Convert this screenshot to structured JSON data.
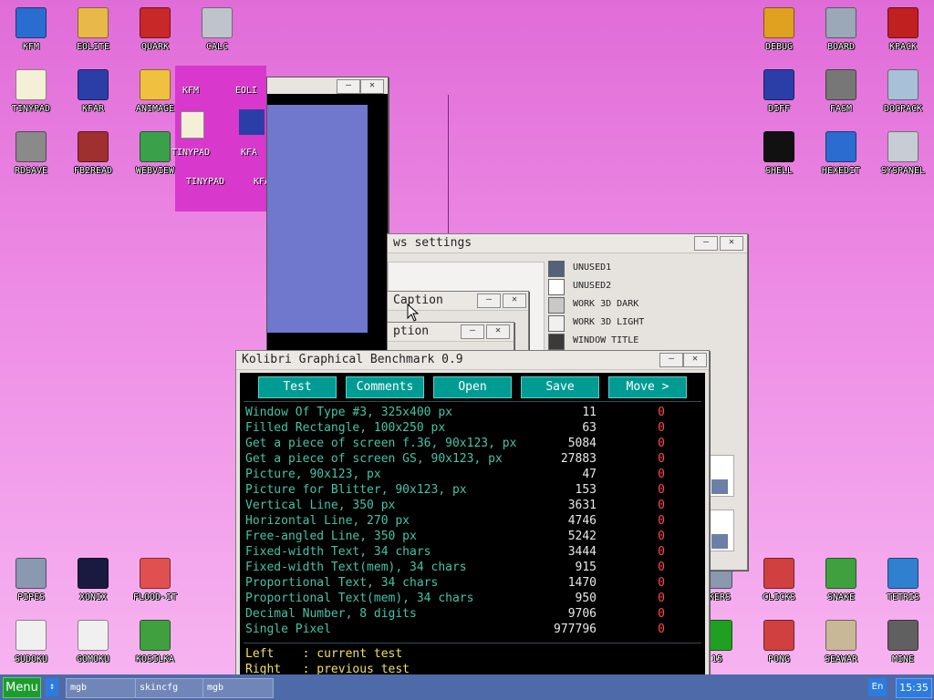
{
  "desktop_icons_left": [
    {
      "label": "KFM",
      "icon": "floppy-icon",
      "color": "#2b6cd0"
    },
    {
      "label": "EOLITE",
      "icon": "folder-icon",
      "color": "#e8b84a"
    },
    {
      "label": "QUARK",
      "icon": "book-icon",
      "color": "#c82828"
    },
    {
      "label": "CALC",
      "icon": "calculator-icon",
      "color": "#bfc4cc"
    },
    {
      "label": "TINYPAD",
      "icon": "notepad-icon",
      "color": "#f4f0d8"
    },
    {
      "label": "KFAR",
      "icon": "far-icon",
      "color": "#2b3ea8"
    },
    {
      "label": "ANIMAGE",
      "icon": "pencil-icon",
      "color": "#f0c040"
    },
    {
      "label": "RDSAVE",
      "icon": "disk-save-icon",
      "color": "#8a8a8a"
    },
    {
      "label": "FB2READ",
      "icon": "fb2-book-icon",
      "color": "#a03030"
    },
    {
      "label": "WEBVIEW",
      "icon": "globe-icon",
      "color": "#3aa04a"
    }
  ],
  "desktop_icons_right": [
    {
      "label": "DEBUG",
      "icon": "bug-icon",
      "color": "#e0a020"
    },
    {
      "label": "BOARD",
      "icon": "board-icon",
      "color": "#9aa8b8"
    },
    {
      "label": "KPACK",
      "icon": "wrench-icon",
      "color": "#c02020"
    },
    {
      "label": "DIFF",
      "icon": "diff-icon",
      "color": "#2b3ea8"
    },
    {
      "label": "FASM",
      "icon": "anvil-icon",
      "color": "#777777"
    },
    {
      "label": "DOCPACK",
      "icon": "cabinet-icon",
      "color": "#a8c0d8"
    },
    {
      "label": "SHELL",
      "icon": "terminal-icon",
      "color": "#111111"
    },
    {
      "label": "HEXEDIT",
      "icon": "hex-icon",
      "color": "#2b6cd0"
    },
    {
      "label": "SYSPANEL",
      "icon": "sliders-icon",
      "color": "#c8ccd4"
    }
  ],
  "desktop_icons_bottom": [
    {
      "label": "PIPES",
      "icon": "pipes-icon",
      "color": "#8a98b0"
    },
    {
      "label": "XONIX",
      "icon": "xonix-icon",
      "color": "#1a1a40"
    },
    {
      "label": "FLOOD-IT",
      "icon": "flood-icon",
      "color": "#e05050"
    },
    {
      "label": "SUDOKU",
      "icon": "sudoku-icon",
      "color": "#f0f0f0"
    },
    {
      "label": "GOMOKU",
      "icon": "gomoku-icon",
      "color": "#f0f0f0"
    },
    {
      "label": "KOSILKA",
      "icon": "mower-icon",
      "color": "#40a040"
    },
    {
      "label": "CKERS",
      "icon": "checkers-icon",
      "color": "#8a98b0"
    },
    {
      "label": "CLICKS",
      "icon": "blocks-icon",
      "color": "#d04040"
    },
    {
      "label": "SNAKE",
      "icon": "snake-icon",
      "color": "#40a040"
    },
    {
      "label": "TETRIS",
      "icon": "tetris-icon",
      "color": "#3080d0"
    },
    {
      "label": "15",
      "icon": "fifteen-icon",
      "color": "#20a020"
    },
    {
      "label": "PONG",
      "icon": "pong-icon",
      "color": "#d04040"
    },
    {
      "label": "SEAWAR",
      "icon": "ship-icon",
      "color": "#c8b898"
    },
    {
      "label": "MINE",
      "icon": "mine-icon",
      "color": "#606060"
    }
  ],
  "ghost_icons": {
    "kfm": "KFM",
    "eoli": "EOLI",
    "tinypad": "TINYPAD",
    "kfa": "KFA",
    "tinypad2": "TINYPAD",
    "kfa2": "KFA",
    "kfa3": "KFA"
  },
  "settings_window": {
    "title": "ws settings",
    "colors": [
      {
        "name": "UNUSED1",
        "color": "#55607a"
      },
      {
        "name": "UNUSED2",
        "color": "#ffffff"
      },
      {
        "name": "WORK 3D DARK",
        "color": "#c8c8c8"
      },
      {
        "name": "WORK 3D LIGHT",
        "color": "#f0f0f0"
      },
      {
        "name": "WINDOW TITLE",
        "color": "#3a3a3a"
      }
    ]
  },
  "caption_window_1": {
    "title": "Caption"
  },
  "caption_window_2": {
    "title": "ption"
  },
  "bench": {
    "title": "Kolibri Graphical Benchmark 0.9",
    "buttons": [
      "Test",
      "Comments",
      "Open",
      "Save",
      "Move >"
    ],
    "rows": [
      {
        "name": "Window Of Type #3, 325x400 px",
        "value": "11",
        "result": "0"
      },
      {
        "name": "Filled Rectangle, 100x250 px",
        "value": "63",
        "result": "0"
      },
      {
        "name": "Get a piece of screen f.36, 90x123, px",
        "value": "5084",
        "result": "0"
      },
      {
        "name": "Get a piece of screen GS, 90x123, px",
        "value": "27883",
        "result": "0"
      },
      {
        "name": "Picture, 90x123, px",
        "value": "47",
        "result": "0"
      },
      {
        "name": "Picture for Blitter, 90x123, px",
        "value": "153",
        "result": "0"
      },
      {
        "name": "Vertical Line, 350 px",
        "value": "3631",
        "result": "0"
      },
      {
        "name": "Horizontal Line, 270 px",
        "value": "4746",
        "result": "0"
      },
      {
        "name": "Free-angled Line, 350 px",
        "value": "5242",
        "result": "0"
      },
      {
        "name": "Fixed-width Text, 34 chars",
        "value": "3444",
        "result": "0"
      },
      {
        "name": "Fixed-width Text(mem), 34 chars",
        "value": "915",
        "result": "0"
      },
      {
        "name": "Proportional Text, 34 chars",
        "value": "1470",
        "result": "0"
      },
      {
        "name": "Proportional Text(mem), 34 chars",
        "value": "950",
        "result": "0"
      },
      {
        "name": "Decimal Number, 8 digits",
        "value": "9706",
        "result": "0"
      },
      {
        "name": "Single Pixel",
        "value": "977796",
        "result": "0"
      }
    ],
    "hint_left": "Left    : current test",
    "hint_right": "Right   : previous test"
  },
  "taskbar": {
    "menu": "Menu",
    "items": [
      "mgb",
      "skincfg",
      "mgb"
    ],
    "lang": "En",
    "clock": "15:35"
  }
}
